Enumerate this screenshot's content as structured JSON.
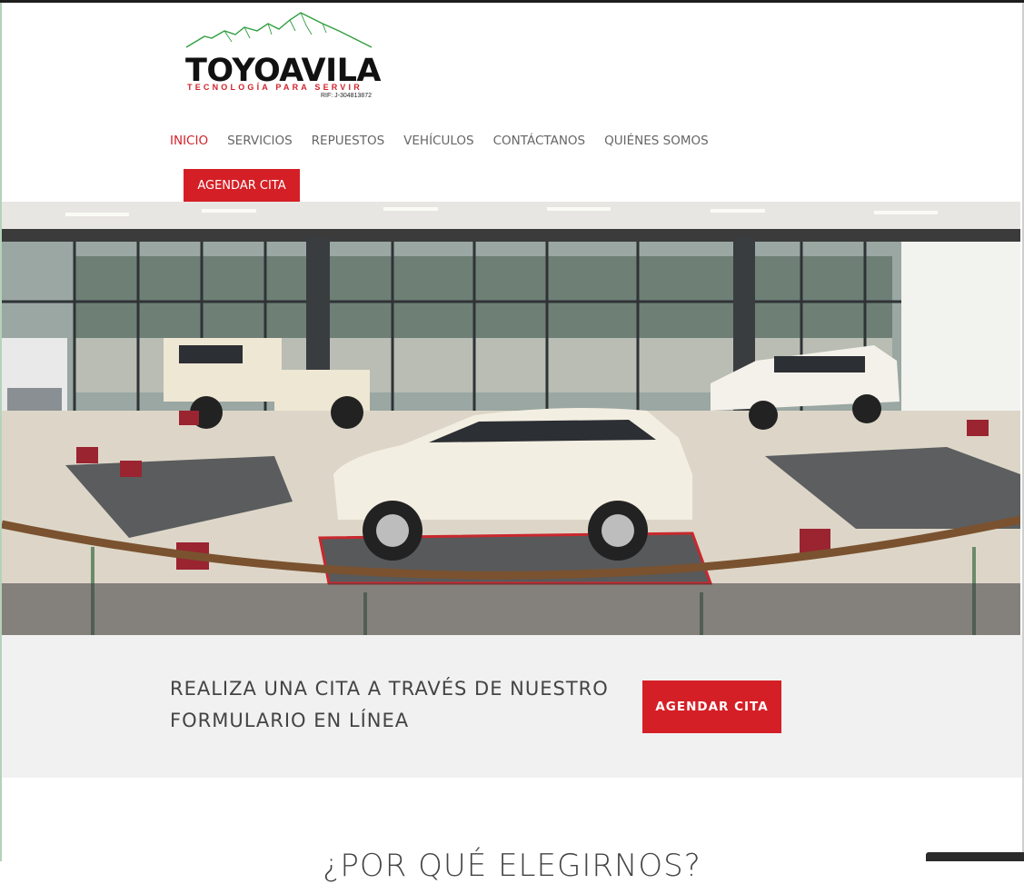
{
  "brand": {
    "name": "TOYOAVILA",
    "tagline": "TECNOLOGÍA PARA SERVIR",
    "rif": "RIF: J-304813872",
    "logo_color": "#2e9e3e",
    "accent_color": "#d51f26"
  },
  "nav": {
    "items": [
      {
        "label": "INICIO",
        "active": true
      },
      {
        "label": "SERVICIOS",
        "active": false
      },
      {
        "label": "REPUESTOS",
        "active": false
      },
      {
        "label": "VEHÍCULOS",
        "active": false
      },
      {
        "label": "CONTÁCTANOS",
        "active": false
      },
      {
        "label": "QUIÉNES SOMOS",
        "active": false
      }
    ],
    "cta_label": "AGENDAR CITA"
  },
  "hero": {
    "image_alt": "showroom-photo"
  },
  "cta_band": {
    "text_line1": "REALIZA UNA CITA A TRAVÉS DE NUESTRO",
    "text_line2": "FORMULARIO EN LÍNEA",
    "button_label": "AGENDAR CITA"
  },
  "section": {
    "title": "¿POR QUÉ ELEGIRNOS?"
  }
}
